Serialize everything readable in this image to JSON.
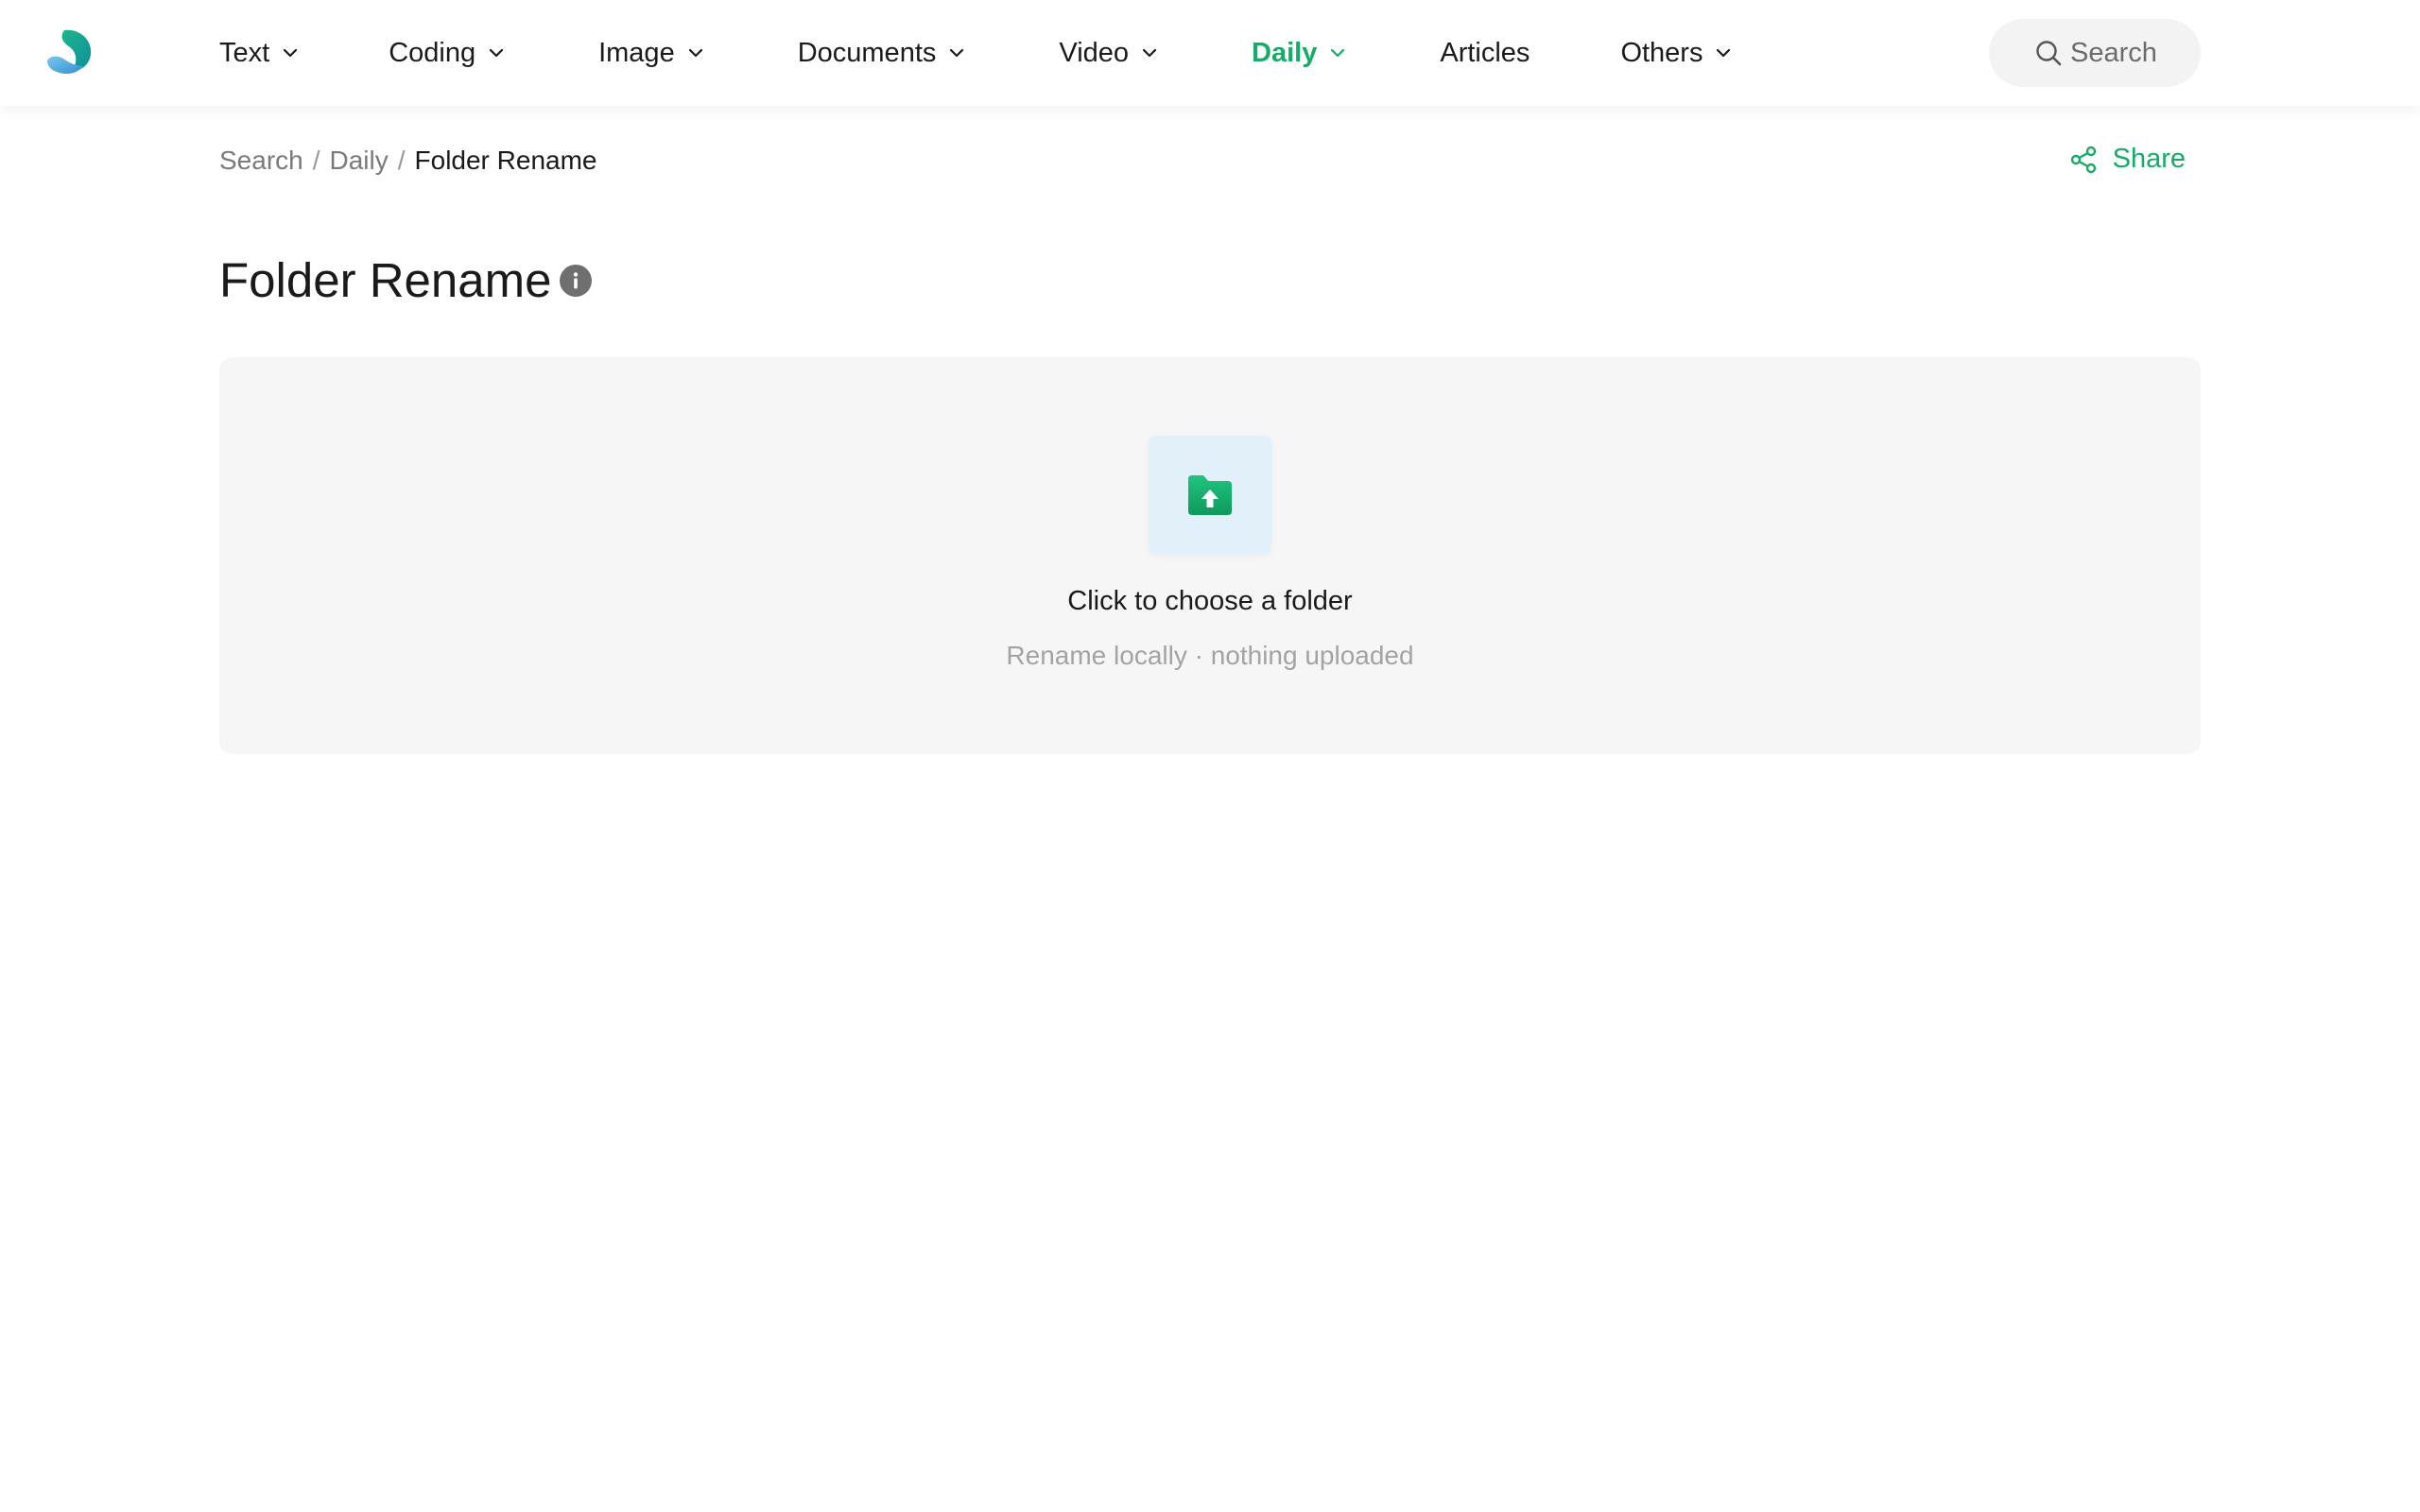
{
  "nav": {
    "items": [
      {
        "label": "Text",
        "has_dropdown": true,
        "active": false
      },
      {
        "label": "Coding",
        "has_dropdown": true,
        "active": false
      },
      {
        "label": "Image",
        "has_dropdown": true,
        "active": false
      },
      {
        "label": "Documents",
        "has_dropdown": true,
        "active": false
      },
      {
        "label": "Video",
        "has_dropdown": true,
        "active": false
      },
      {
        "label": "Daily",
        "has_dropdown": true,
        "active": true
      },
      {
        "label": "Articles",
        "has_dropdown": false,
        "active": false
      },
      {
        "label": "Others",
        "has_dropdown": true,
        "active": false
      }
    ],
    "search_label": "Search"
  },
  "breadcrumb": {
    "items": [
      "Search",
      "Daily",
      "Folder Rename"
    ],
    "separator": "/"
  },
  "share_label": "Share",
  "page": {
    "title": "Folder Rename"
  },
  "upload": {
    "title": "Click to choose a folder",
    "subtitle": "Rename locally · nothing uploaded",
    "icon": "folder-upload-icon"
  },
  "colors": {
    "accent": "#16ab67",
    "panel_bg": "#f6f6f6",
    "tile_bg": "#e2f0f9"
  }
}
